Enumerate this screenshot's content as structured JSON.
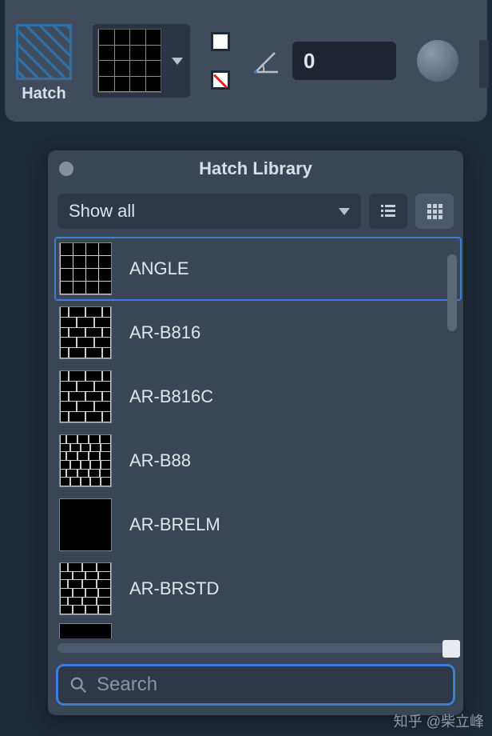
{
  "toolbar": {
    "hatch_label": "Hatch",
    "angle_value": "0"
  },
  "panel": {
    "title": "Hatch Library",
    "filter_label": "Show all",
    "search_placeholder": "Search",
    "selected_index": 0,
    "items": [
      {
        "name": "ANGLE",
        "pattern": "angle"
      },
      {
        "name": "AR-B816",
        "pattern": "brick5"
      },
      {
        "name": "AR-B816C",
        "pattern": "brick5"
      },
      {
        "name": "AR-B88",
        "pattern": "brick6"
      },
      {
        "name": "AR-BRELM",
        "pattern": "elm"
      },
      {
        "name": "AR-BRSTD",
        "pattern": "brick6b"
      },
      {
        "name": "",
        "pattern": "dots"
      }
    ]
  },
  "watermark": "知乎 @柴立峰"
}
